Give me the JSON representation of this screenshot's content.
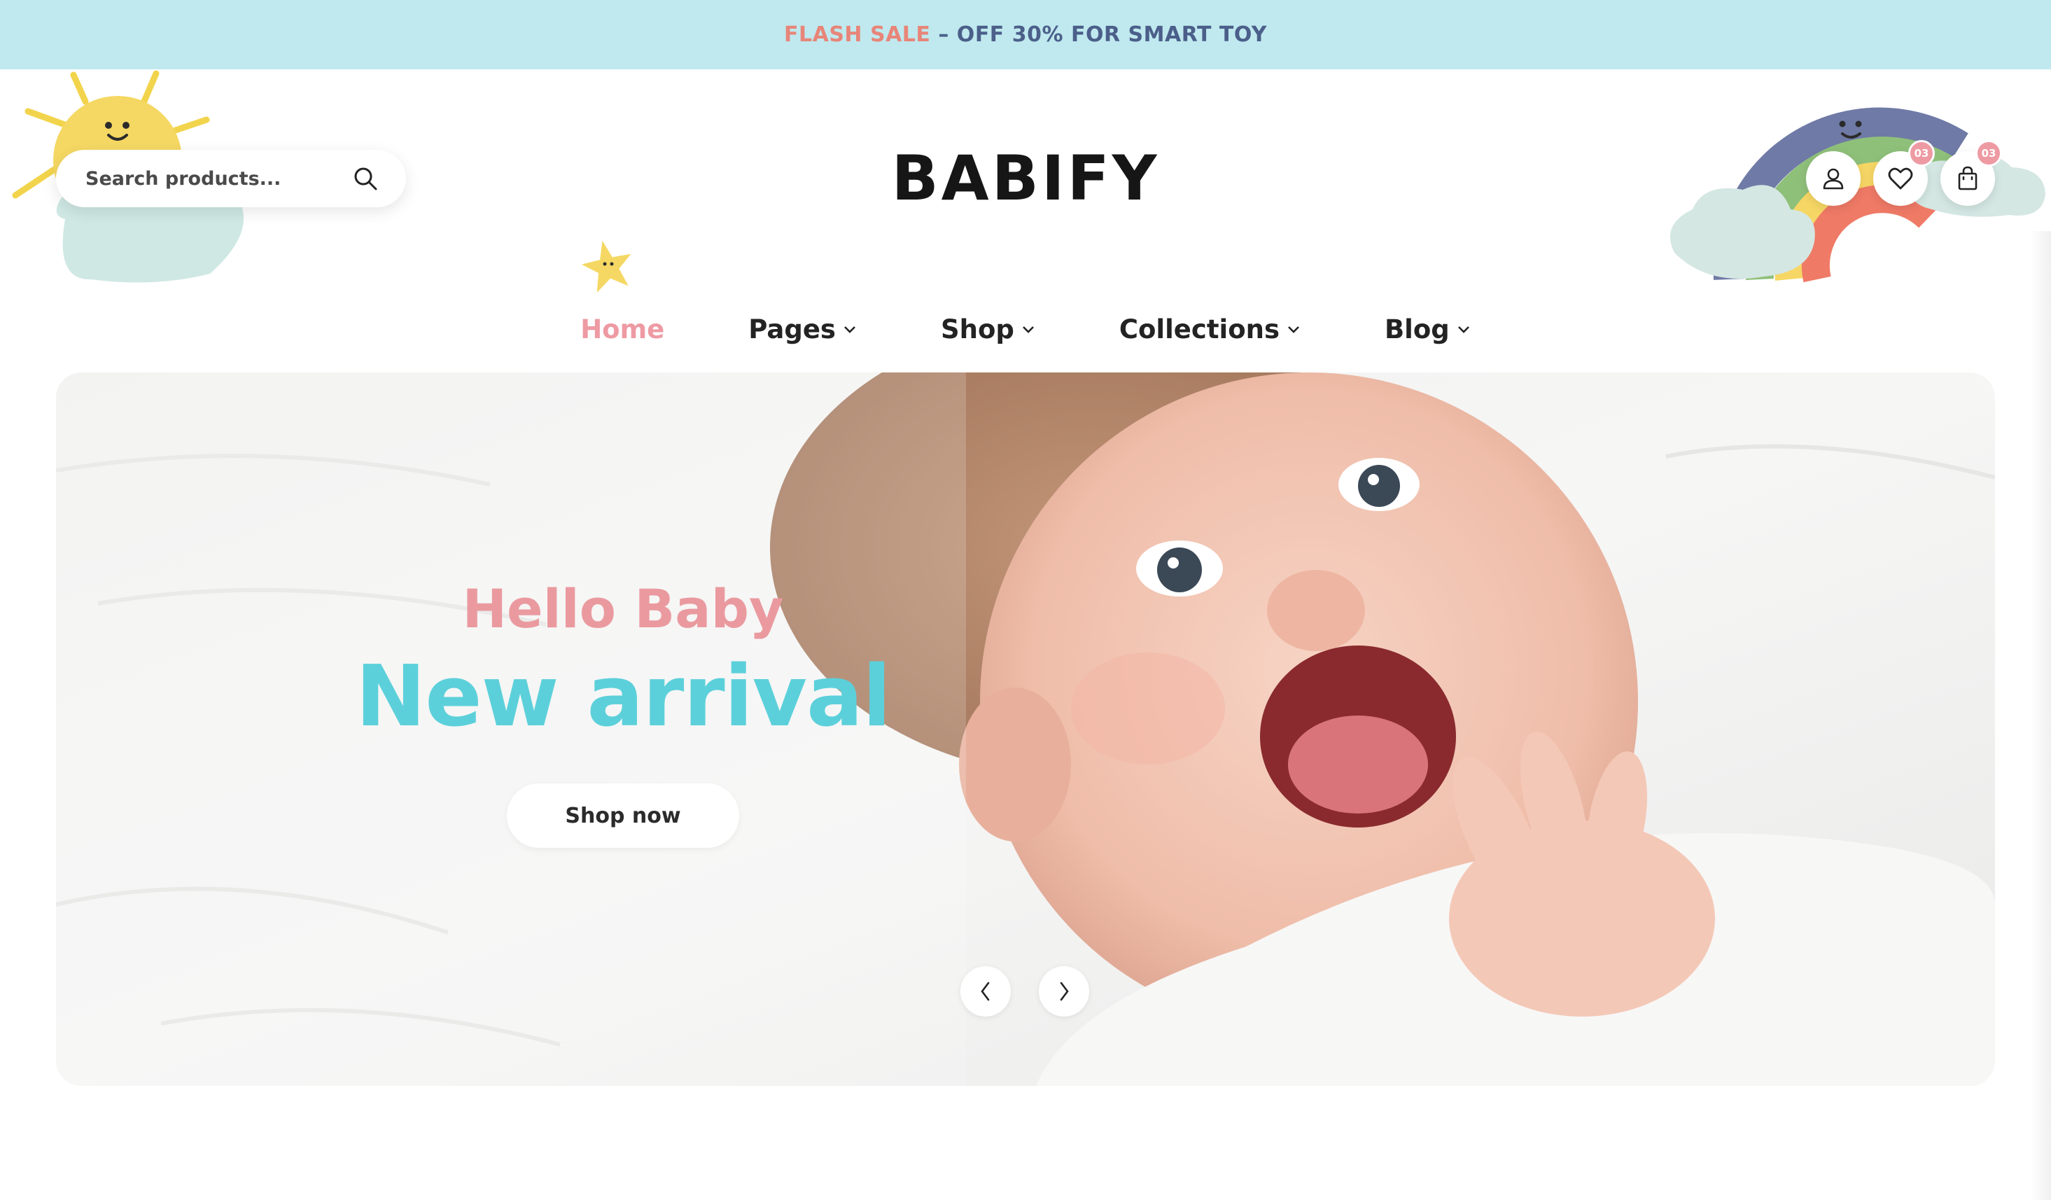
{
  "announcement": {
    "highlight": "FLASH SALE",
    "text": " – OFF 30% FOR SMART TOY",
    "colors": {
      "highlight": "#e88579",
      "text": "#4b5f8a",
      "background": "#bfe9ee"
    }
  },
  "header": {
    "logo": "BABIFY",
    "search": {
      "placeholder": "Search products...",
      "icon": "search-icon"
    },
    "actions": [
      {
        "name": "account",
        "icon": "user-icon"
      },
      {
        "name": "wishlist",
        "icon": "heart-icon",
        "badge": "03"
      },
      {
        "name": "cart",
        "icon": "shopping-bag-icon",
        "badge": "03"
      }
    ]
  },
  "nav": {
    "items": [
      {
        "label": "Home",
        "active": true,
        "dropdown": false
      },
      {
        "label": "Pages",
        "active": false,
        "dropdown": true
      },
      {
        "label": "Shop",
        "active": false,
        "dropdown": true
      },
      {
        "label": "Collections",
        "active": false,
        "dropdown": true
      },
      {
        "label": "Blog",
        "active": false,
        "dropdown": true
      }
    ],
    "active_color": "#ee9aa3"
  },
  "hero": {
    "kicker": "Hello Baby",
    "title": "New arrival",
    "cta": "Shop now",
    "prev_icon": "chevron-left-icon",
    "next_icon": "chevron-right-icon",
    "colors": {
      "kicker": "#ea9a9f",
      "title": "#5cd0da"
    }
  }
}
